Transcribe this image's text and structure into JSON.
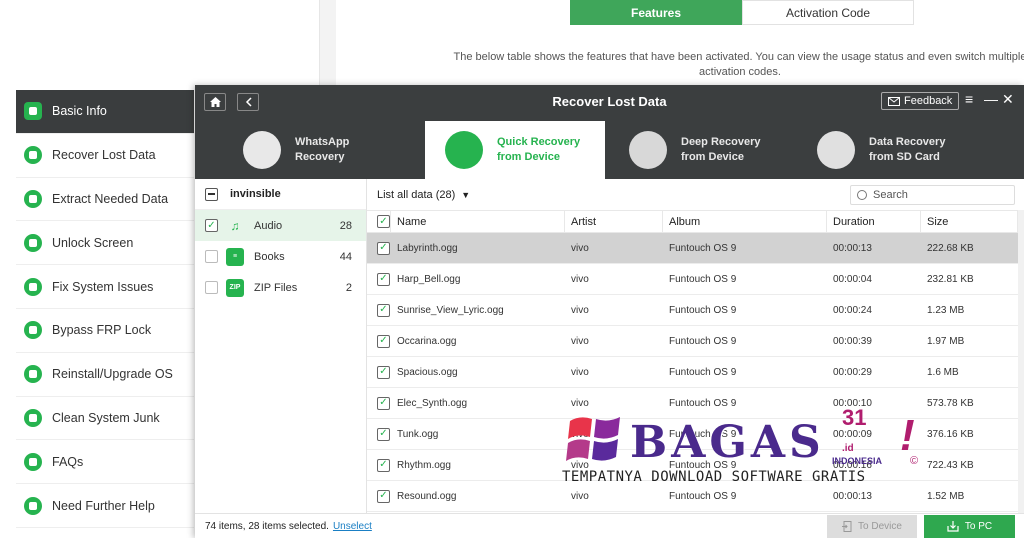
{
  "background": {
    "tabs": [
      {
        "label": "Features",
        "active": true
      },
      {
        "label": "Activation Code",
        "active": false
      }
    ],
    "description_line1": "The below table shows the features that have been activated. You can view the usage status and even switch multiple",
    "description_line2": "activation codes."
  },
  "sidebar": {
    "items": [
      {
        "label": "Basic Info",
        "icon": "info-icon",
        "active": true
      },
      {
        "label": "Recover Lost Data",
        "icon": "recover-icon",
        "active": false
      },
      {
        "label": "Extract Needed Data",
        "icon": "extract-icon",
        "active": false
      },
      {
        "label": "Unlock Screen",
        "icon": "lock-icon",
        "active": false
      },
      {
        "label": "Fix System Issues",
        "icon": "wrench-icon",
        "active": false
      },
      {
        "label": "Bypass FRP Lock",
        "icon": "key-icon",
        "active": false
      },
      {
        "label": "Reinstall/Upgrade OS",
        "icon": "android-icon",
        "active": false
      },
      {
        "label": "Clean System Junk",
        "icon": "broom-icon",
        "active": false
      },
      {
        "label": "FAQs",
        "icon": "question-icon",
        "active": false
      },
      {
        "label": "Need Further Help",
        "icon": "help-icon",
        "active": false
      }
    ]
  },
  "window": {
    "title": "Recover Lost Data",
    "feedback_label": "Feedback",
    "modes": [
      {
        "line1": "WhatsApp",
        "line2": "Recovery",
        "icon": "whatsapp-icon",
        "active": false
      },
      {
        "line1": "Quick Recovery",
        "line2": "from Device",
        "icon": "quick-recovery-icon",
        "active": true
      },
      {
        "line1": "Deep Recovery",
        "line2": "from Device",
        "icon": "deep-recovery-icon",
        "active": false
      },
      {
        "line1": "Data Recovery",
        "line2": "from SD Card",
        "icon": "sd-card-icon",
        "active": false
      }
    ],
    "categories_header": "invinsible",
    "categories": [
      {
        "name": "Audio",
        "count": "28",
        "icon": "music-note-icon",
        "checked": true,
        "active": true
      },
      {
        "name": "Books",
        "count": "44",
        "icon": "book-icon",
        "checked": false,
        "active": false
      },
      {
        "name": "ZIP Files",
        "count": "2",
        "icon": "zip-icon",
        "checked": false,
        "active": false
      }
    ],
    "list_filter": "List all data (28)",
    "search_placeholder": "Search",
    "columns": [
      "Name",
      "Artist",
      "Album",
      "Duration",
      "Size"
    ],
    "rows": [
      {
        "name": "Labyrinth.ogg",
        "artist": "vivo",
        "album": "Funtouch OS 9",
        "duration": "00:00:13",
        "size": "222.68 KB",
        "highlight": true
      },
      {
        "name": "Harp_Bell.ogg",
        "artist": "vivo",
        "album": "Funtouch OS 9",
        "duration": "00:00:04",
        "size": "232.81 KB",
        "highlight": false
      },
      {
        "name": "Sunrise_View_Lyric.ogg",
        "artist": "vivo",
        "album": "Funtouch OS 9",
        "duration": "00:00:24",
        "size": "1.23 MB",
        "highlight": false
      },
      {
        "name": "Occarina.ogg",
        "artist": "vivo",
        "album": "Funtouch OS 9",
        "duration": "00:00:39",
        "size": "1.97 MB",
        "highlight": false
      },
      {
        "name": "Spacious.ogg",
        "artist": "vivo",
        "album": "Funtouch OS 9",
        "duration": "00:00:29",
        "size": "1.6 MB",
        "highlight": false
      },
      {
        "name": "Elec_Synth.ogg",
        "artist": "vivo",
        "album": "Funtouch OS 9",
        "duration": "00:00:10",
        "size": "573.78 KB",
        "highlight": false
      },
      {
        "name": "Tunk.ogg",
        "artist": "vivo",
        "album": "Funtouch OS 9",
        "duration": "00:00:09",
        "size": "376.16 KB",
        "highlight": false
      },
      {
        "name": "Rhythm.ogg",
        "artist": "vivo",
        "album": "Funtouch OS 9",
        "duration": "00:00:16",
        "size": "722.43 KB",
        "highlight": false
      },
      {
        "name": "Resound.ogg",
        "artist": "vivo",
        "album": "Funtouch OS 9",
        "duration": "00:00:13",
        "size": "1.52 MB",
        "highlight": false
      }
    ],
    "footer_status": "74 items, 28 items selected.",
    "unselect_label": "Unselect",
    "to_device_label": "To Device",
    "to_pc_label": "To PC"
  },
  "watermark": {
    "brand": "BAGAS",
    "num": "31",
    "dotid": ".id",
    "country": "INDONESIA",
    "excl": "!",
    "copyright": "©",
    "tagline": "TEMPATNYA DOWNLOAD SOFTWARE GRATIS"
  },
  "colors": {
    "accent": "#26b34f",
    "titlebar": "#3b3e3f",
    "link": "#1a7fc4"
  }
}
